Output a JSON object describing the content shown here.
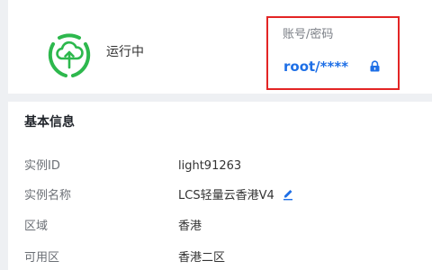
{
  "status": {
    "text": "运行中",
    "icon": "cloud-upload-icon",
    "color": "#2db84d"
  },
  "credentials": {
    "label": "账号/密码",
    "value": "root/****",
    "icon": "lock-icon",
    "color": "#1e6fe6",
    "highlight_color": "#e32525"
  },
  "basic_info": {
    "title": "基本信息",
    "rows": [
      {
        "label": "实例ID",
        "value": "light91263"
      },
      {
        "label": "实例名称",
        "value": "LCS轻量云香港V4",
        "icon": "edit-icon"
      },
      {
        "label": "区域",
        "value": "香港"
      },
      {
        "label": "可用区",
        "value": "香港二区"
      }
    ]
  }
}
